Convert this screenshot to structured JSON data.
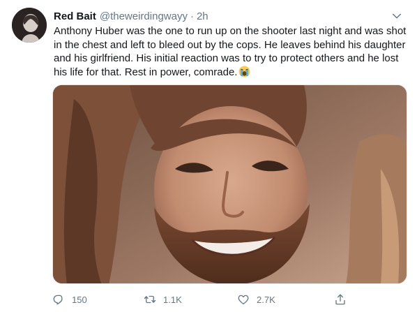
{
  "tweet": {
    "display_name": "Red Bait",
    "handle": "@theweirdingwayy",
    "separator": "·",
    "time": "2h",
    "text": "Anthony Huber was the one to run up on the shooter last night and was shot in the chest and left to bleed out by the cops. He leaves behind his daughter and his girlfriend. His initial reaction was to try to protect others and he lost his life for that. Rest in power, comrade.",
    "emoji": "crying-face-emoji",
    "media_icon": "photo"
  },
  "actions": {
    "reply_count": "150",
    "retweet_count": "1.1K",
    "like_count": "2.7K",
    "icons": [
      "reply-icon",
      "retweet-icon",
      "like-icon",
      "share-icon"
    ]
  },
  "colors": {
    "text": "#14171a",
    "secondary": "#657786",
    "border": "#e1e8ed"
  }
}
